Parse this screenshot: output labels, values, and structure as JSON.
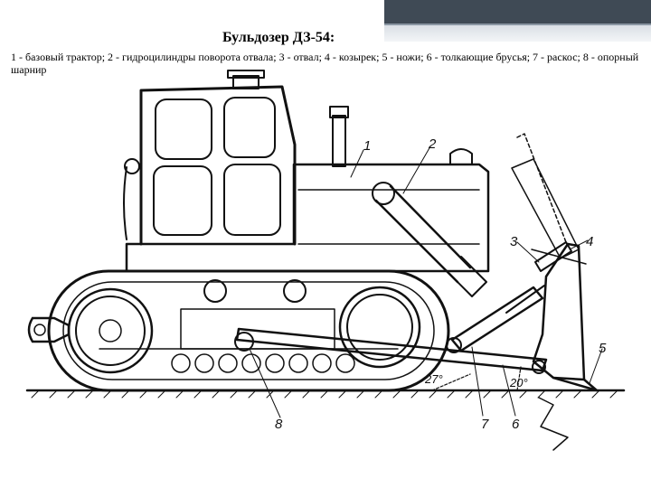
{
  "slide": {
    "title": "Бульдозер ДЗ-54:",
    "caption": "1 - базовый трактор; 2 - гидроцилиндры поворота отвала; 3 - отвал; 4 - козырек; 5 - ножи; 6 - толкающие брусья; 7 - раскос; 8 - опорный шарнир"
  },
  "drawing": {
    "callouts": [
      "1",
      "2",
      "3",
      "4",
      "5",
      "6",
      "7",
      "8"
    ],
    "angles": [
      "27°",
      "20°"
    ]
  }
}
